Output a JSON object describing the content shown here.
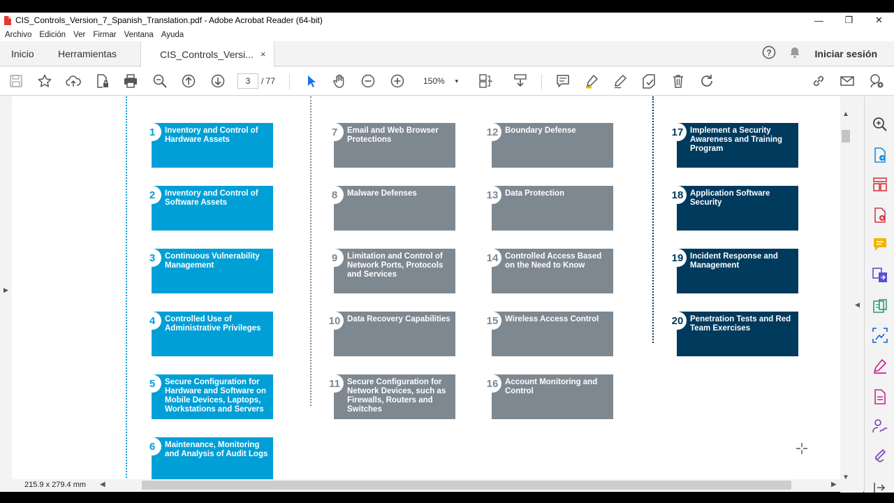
{
  "window": {
    "title": "CIS_Controls_Version_7_Spanish_Translation.pdf - Adobe Acrobat Reader (64-bit)",
    "minimize": "—",
    "restore": "❐",
    "close": "✕"
  },
  "menu": [
    "Archivo",
    "Edición",
    "Ver",
    "Firmar",
    "Ventana",
    "Ayuda"
  ],
  "tabs": {
    "home": "Inicio",
    "tools": "Herramientas",
    "document": "CIS_Controls_Versi...",
    "close": "×",
    "signin": "Iniciar sesión"
  },
  "toolbar": {
    "current_page": "3",
    "page_count": "/ 77",
    "zoom": "150%",
    "zoom_caret": "▾"
  },
  "document": {
    "columns": [
      {
        "color": "blue",
        "controls": [
          {
            "num": "1",
            "text": "Inventory and Control of Hardware Assets"
          },
          {
            "num": "2",
            "text": "Inventory and Control of Software Assets"
          },
          {
            "num": "3",
            "text": "Continuous Vulnerability Management"
          },
          {
            "num": "4",
            "text": "Controlled Use of Administrative Privileges"
          },
          {
            "num": "5",
            "text": "Secure Configuration for Hardware and Software on Mobile Devices, Laptops, Workstations and Servers"
          },
          {
            "num": "6",
            "text": "Maintenance, Monitoring and Analysis of Audit Logs"
          }
        ]
      },
      {
        "color": "gray",
        "controls": [
          {
            "num": "7",
            "text": "Email and Web Browser Protections"
          },
          {
            "num": "8",
            "text": "Malware Defenses"
          },
          {
            "num": "9",
            "text": "Limitation and Control of Network Ports, Protocols and Services"
          },
          {
            "num": "10",
            "text": "Data Recovery Capabilities"
          },
          {
            "num": "11",
            "text": "Secure Configuration for Network Devices, such as Firewalls, Routers and Switches"
          }
        ]
      },
      {
        "color": "gray",
        "controls": [
          {
            "num": "12",
            "text": "Boundary Defense"
          },
          {
            "num": "13",
            "text": "Data Protection"
          },
          {
            "num": "14",
            "text": "Controlled Access Based on the Need to Know"
          },
          {
            "num": "15",
            "text": "Wireless Access Control"
          },
          {
            "num": "16",
            "text": "Account Monitoring and Control"
          }
        ]
      },
      {
        "color": "navy",
        "controls": [
          {
            "num": "17",
            "text": "Implement a Security Awareness and Training Program"
          },
          {
            "num": "18",
            "text": "Application Software Security"
          },
          {
            "num": "19",
            "text": "Incident Response and Management"
          },
          {
            "num": "20",
            "text": "Penetration Tests and Red Team Exercises"
          }
        ]
      }
    ]
  },
  "statusbar": {
    "page_size": "215.9 x 279.4 mm"
  },
  "colors": {
    "blue": "#009fd6",
    "gray": "#7e8891",
    "navy": "#003a5d",
    "accent_select": "#1473e6"
  }
}
